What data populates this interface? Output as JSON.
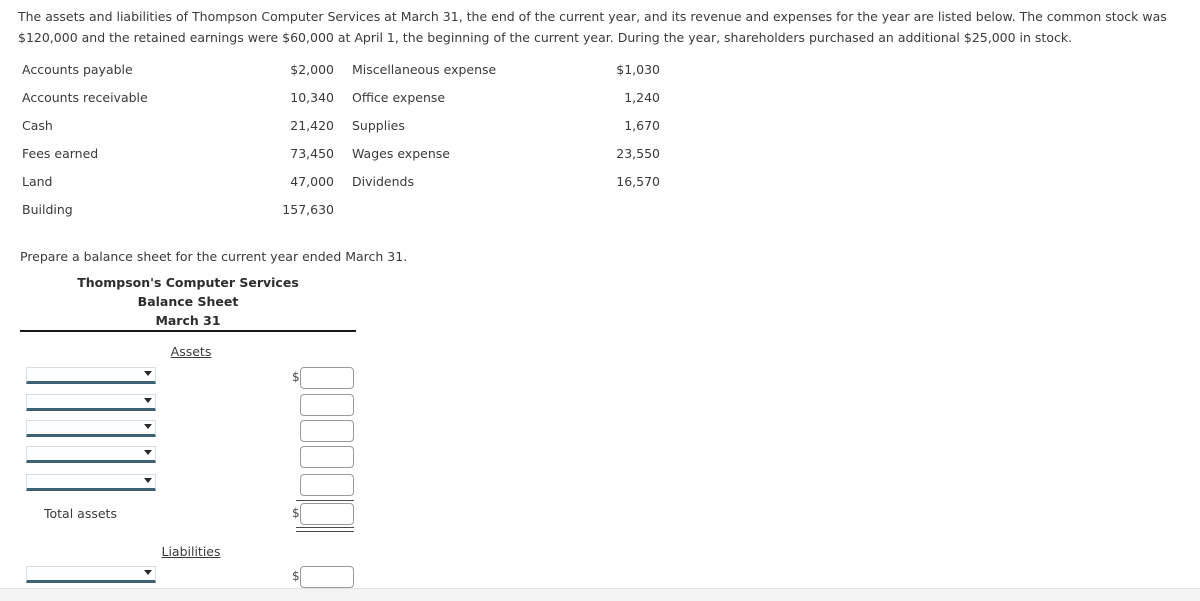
{
  "intro": {
    "paragraph": "The assets and liabilities of Thompson Computer Services at March 31, the end of the current year, and its revenue and expenses for the year are listed below. The common stock was $120,000 and the retained earnings were $60,000 at April 1, the beginning of the current year. During the year, shareholders purchased an additional $25,000 in stock."
  },
  "accounts": {
    "rows": [
      {
        "left_name": "Accounts payable",
        "left_value": "$2,000",
        "right_name": "Miscellaneous expense",
        "right_value": "$1,030"
      },
      {
        "left_name": "Accounts receivable",
        "left_value": "10,340",
        "right_name": "Office expense",
        "right_value": "1,240"
      },
      {
        "left_name": "Cash",
        "left_value": "21,420",
        "right_name": "Supplies",
        "right_value": "1,670"
      },
      {
        "left_name": "Fees earned",
        "left_value": "73,450",
        "right_name": "Wages expense",
        "right_value": "23,550"
      },
      {
        "left_name": "Land",
        "left_value": "47,000",
        "right_name": "Dividends",
        "right_value": "16,570"
      },
      {
        "left_name": "Building",
        "left_value": "157,630",
        "right_name": "",
        "right_value": ""
      }
    ]
  },
  "prompt": {
    "text": "Prepare a balance sheet for the current year ended March 31."
  },
  "statement": {
    "company": "Thompson's Computer Services",
    "title": "Balance Sheet",
    "date": "March 31"
  },
  "sections": {
    "assets_label": "Liabilities",
    "assets": "Assets",
    "liabilities": "Liabilities"
  },
  "assets_section": {
    "line_items": [
      {
        "account": "",
        "amount": "",
        "dollar": true
      },
      {
        "account": "",
        "amount": "",
        "dollar": false
      },
      {
        "account": "",
        "amount": "",
        "dollar": false
      },
      {
        "account": "",
        "amount": "",
        "dollar": false
      },
      {
        "account": "",
        "amount": "",
        "dollar": false
      }
    ],
    "total_label": "Total assets",
    "total_amount": "",
    "total_dollar": true
  },
  "liabilities_section": {
    "line_items": [
      {
        "account": "",
        "amount": "",
        "dollar": true
      }
    ]
  },
  "controls": {
    "dropdown_placeholder": "",
    "amount_placeholder": "",
    "currency_symbol": "$",
    "dropdown_icon": "chevron-down-icon"
  },
  "colors": {
    "text": "#3a3a3a",
    "heading": "#2d2d2d",
    "select_underline": "#3d6175",
    "input_border": "#9a9a9a",
    "rule": "#1a1a1a"
  }
}
